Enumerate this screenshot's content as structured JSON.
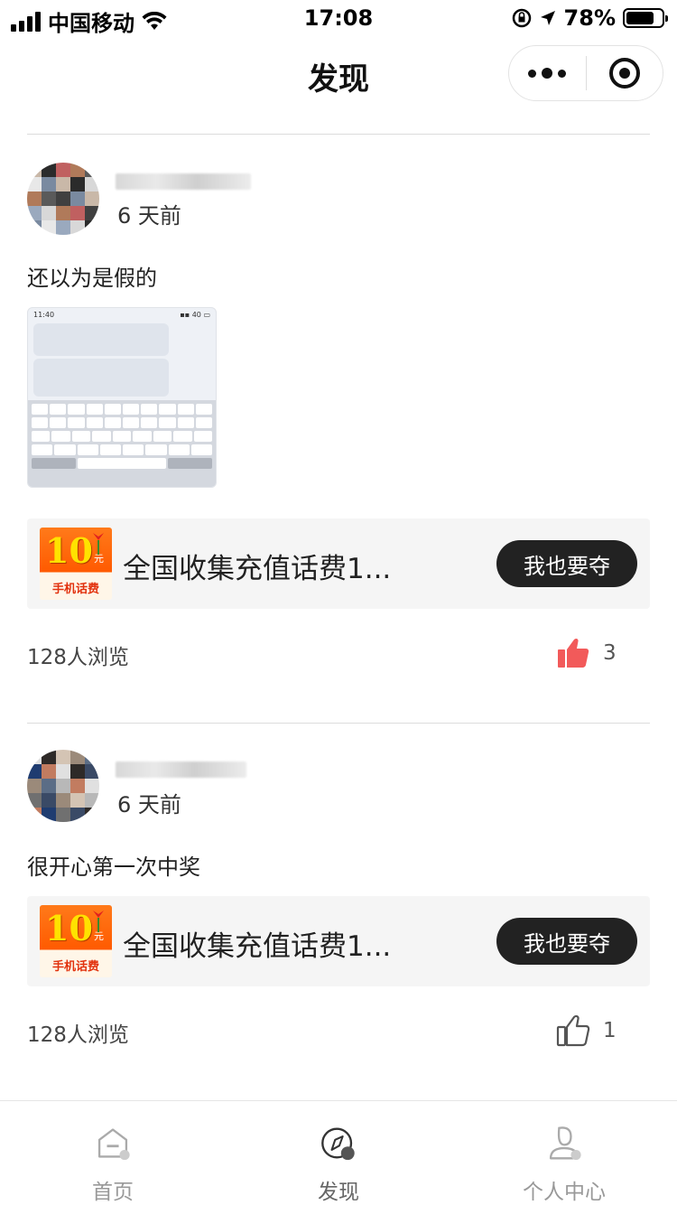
{
  "status_bar": {
    "carrier": "中国移动",
    "time": "17:08",
    "battery": "78%",
    "battery_level": 0.78
  },
  "nav": {
    "title": "发现"
  },
  "posts": [
    {
      "time": "6 天前",
      "text": "还以为是假的",
      "card": {
        "thumb_value": "10",
        "thumb_unit": "元",
        "thumb_label": "手机话费",
        "title": "全国收集充值话费1...",
        "button": "我也要夺"
      },
      "views": "128人浏览",
      "likes": "3",
      "liked": true
    },
    {
      "time": "6 天前",
      "text": "很开心第一次中奖",
      "card": {
        "thumb_value": "10",
        "thumb_unit": "元",
        "thumb_label": "手机话费",
        "title": "全国收集充值话费1...",
        "button": "我也要夺"
      },
      "views": "128人浏览",
      "likes": "1",
      "liked": false
    }
  ],
  "tabbar": {
    "items": [
      {
        "label": "首页",
        "icon": "home-icon"
      },
      {
        "label": "发现",
        "icon": "compass-icon"
      },
      {
        "label": "个人中心",
        "icon": "user-icon"
      }
    ],
    "active": 1
  },
  "colors": {
    "like_active": "#f25a5a",
    "button_bg": "#222222",
    "card_bg": "#f5f5f5"
  }
}
